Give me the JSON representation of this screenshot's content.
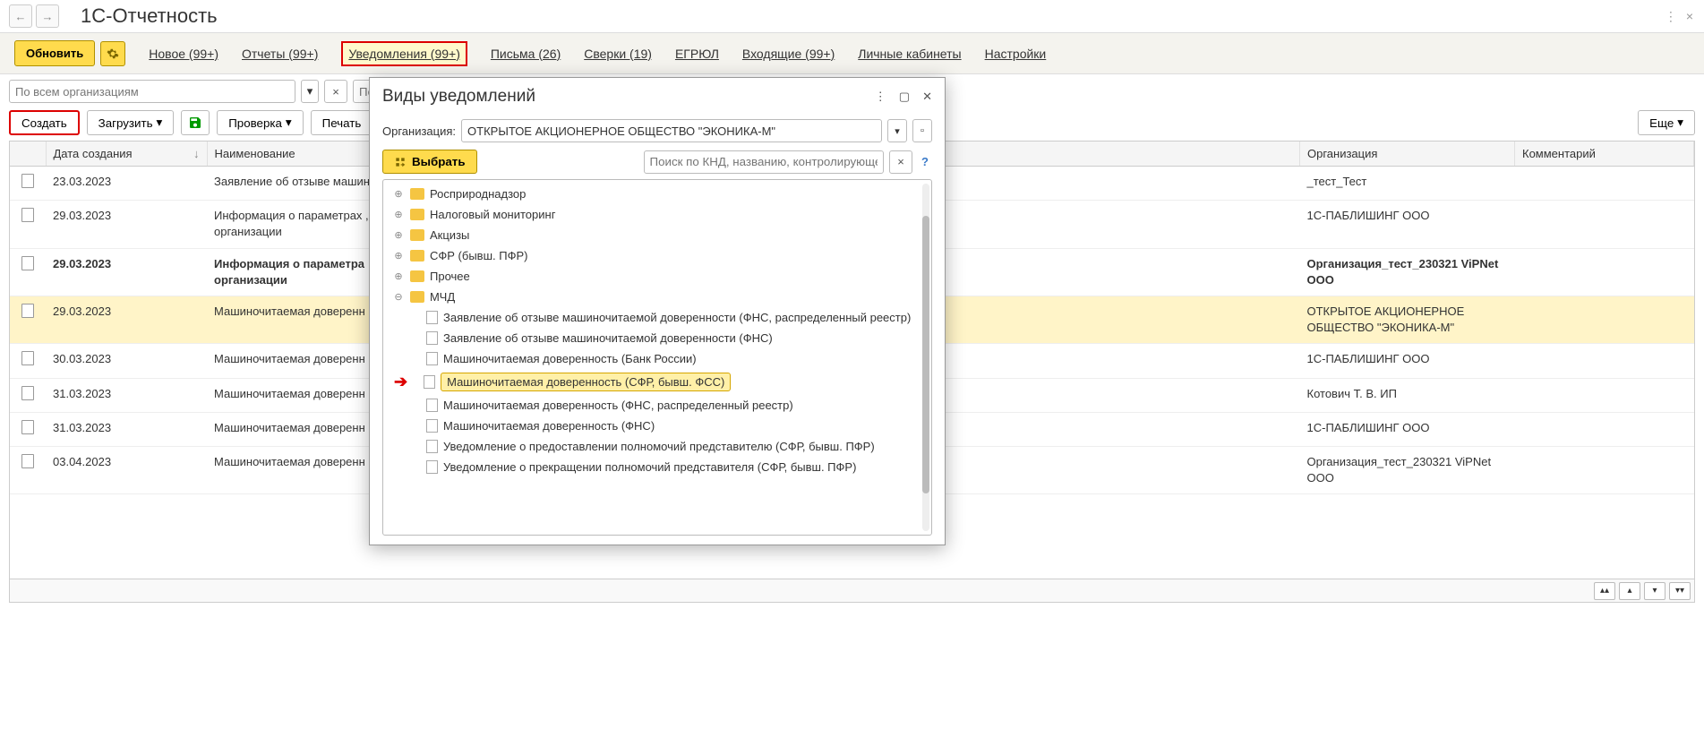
{
  "app_title": "1С-Отчетность",
  "nav": {
    "refresh": "Обновить",
    "links": [
      {
        "label": "Новое (99+)",
        "highlight": false
      },
      {
        "label": "Отчеты (99+)",
        "highlight": false
      },
      {
        "label": "Уведомления (99+)",
        "highlight": true
      },
      {
        "label": "Письма (26)",
        "highlight": false
      },
      {
        "label": "Сверки (19)",
        "highlight": false
      },
      {
        "label": "ЕГРЮЛ",
        "highlight": false
      },
      {
        "label": "Входящие (99+)",
        "highlight": false
      },
      {
        "label": "Личные кабинеты",
        "highlight": false
      },
      {
        "label": "Настройки",
        "highlight": false
      }
    ]
  },
  "filters": {
    "org_filter": "По всем организациям",
    "search_placeholder": "Пои"
  },
  "toolbar": {
    "create": "Создать",
    "load": "Загрузить",
    "check": "Проверка",
    "print": "Печать",
    "more": "Еще"
  },
  "table": {
    "headers": {
      "date": "Дата создания",
      "name": "Наименование",
      "org": "Организация",
      "comment": "Комментарий"
    },
    "rows": [
      {
        "date": "23.03.2023",
        "name": "Заявление об отзыве машин",
        "org": "_тест_Тест",
        "bold": false,
        "yellow": false
      },
      {
        "date": "29.03.2023",
        "name": "Информация о параметрах ,\nорганизации",
        "org": "1С-ПАБЛИШИНГ ООО",
        "bold": false,
        "yellow": false
      },
      {
        "date": "29.03.2023",
        "name": "Информация о параметра\nорганизации",
        "org": "Организация_тест_230321 ViPNet ООО",
        "bold": true,
        "yellow": false
      },
      {
        "date": "29.03.2023",
        "name": "Машиночитаемая доверенн",
        "org": "ОТКРЫТОЕ АКЦИОНЕРНОЕ ОБЩЕСТВО \"ЭКОНИКА-М\"",
        "bold": false,
        "yellow": true
      },
      {
        "date": "30.03.2023",
        "name": "Машиночитаемая доверенн",
        "org": "1С-ПАБЛИШИНГ ООО",
        "bold": false,
        "yellow": false
      },
      {
        "date": "31.03.2023",
        "name": "Машиночитаемая доверенн",
        "org": "Котович Т. В. ИП",
        "bold": false,
        "yellow": false
      },
      {
        "date": "31.03.2023",
        "name": "Машиночитаемая доверенн",
        "org": "1С-ПАБЛИШИНГ ООО",
        "bold": false,
        "yellow": false
      },
      {
        "date": "03.04.2023",
        "name": "Машиночитаемая доверенн",
        "org": "Организация_тест_230321 ViPNet ООО",
        "bold": false,
        "yellow": false
      }
    ]
  },
  "dialog": {
    "title": "Виды уведомлений",
    "org_label": "Организация:",
    "org_value": "ОТКРЫТОЕ АКЦИОНЕРНОЕ ОБЩЕСТВО \"ЭКОНИКА-М\"",
    "select_btn": "Выбрать",
    "search_placeholder": "Поиск по КНД, названию, контролирующему о...",
    "tree": {
      "folders": [
        {
          "label": "Росприроднадзор",
          "expanded": false
        },
        {
          "label": "Налоговый мониторинг",
          "expanded": false
        },
        {
          "label": "Акцизы",
          "expanded": false
        },
        {
          "label": "СФР (бывш. ПФР)",
          "expanded": false
        },
        {
          "label": "Прочее",
          "expanded": false
        },
        {
          "label": "МЧД",
          "expanded": true
        }
      ],
      "leaves": [
        {
          "label": "Заявление об отзыве машиночитаемой доверенности (ФНС, распределенный реестр)",
          "selected": false
        },
        {
          "label": "Заявление об отзыве машиночитаемой доверенности (ФНС)",
          "selected": false
        },
        {
          "label": "Машиночитаемая доверенность (Банк России)",
          "selected": false
        },
        {
          "label": "Машиночитаемая доверенность (СФР, бывш. ФСС)",
          "selected": true
        },
        {
          "label": "Машиночитаемая доверенность (ФНС, распределенный реестр)",
          "selected": false
        },
        {
          "label": "Машиночитаемая доверенность (ФНС)",
          "selected": false
        },
        {
          "label": "Уведомление о предоставлении полномочий представителю (СФР, бывш. ПФР)",
          "selected": false
        },
        {
          "label": "Уведомление о прекращении полномочий представителя (СФР, бывш. ПФР)",
          "selected": false
        }
      ]
    }
  }
}
